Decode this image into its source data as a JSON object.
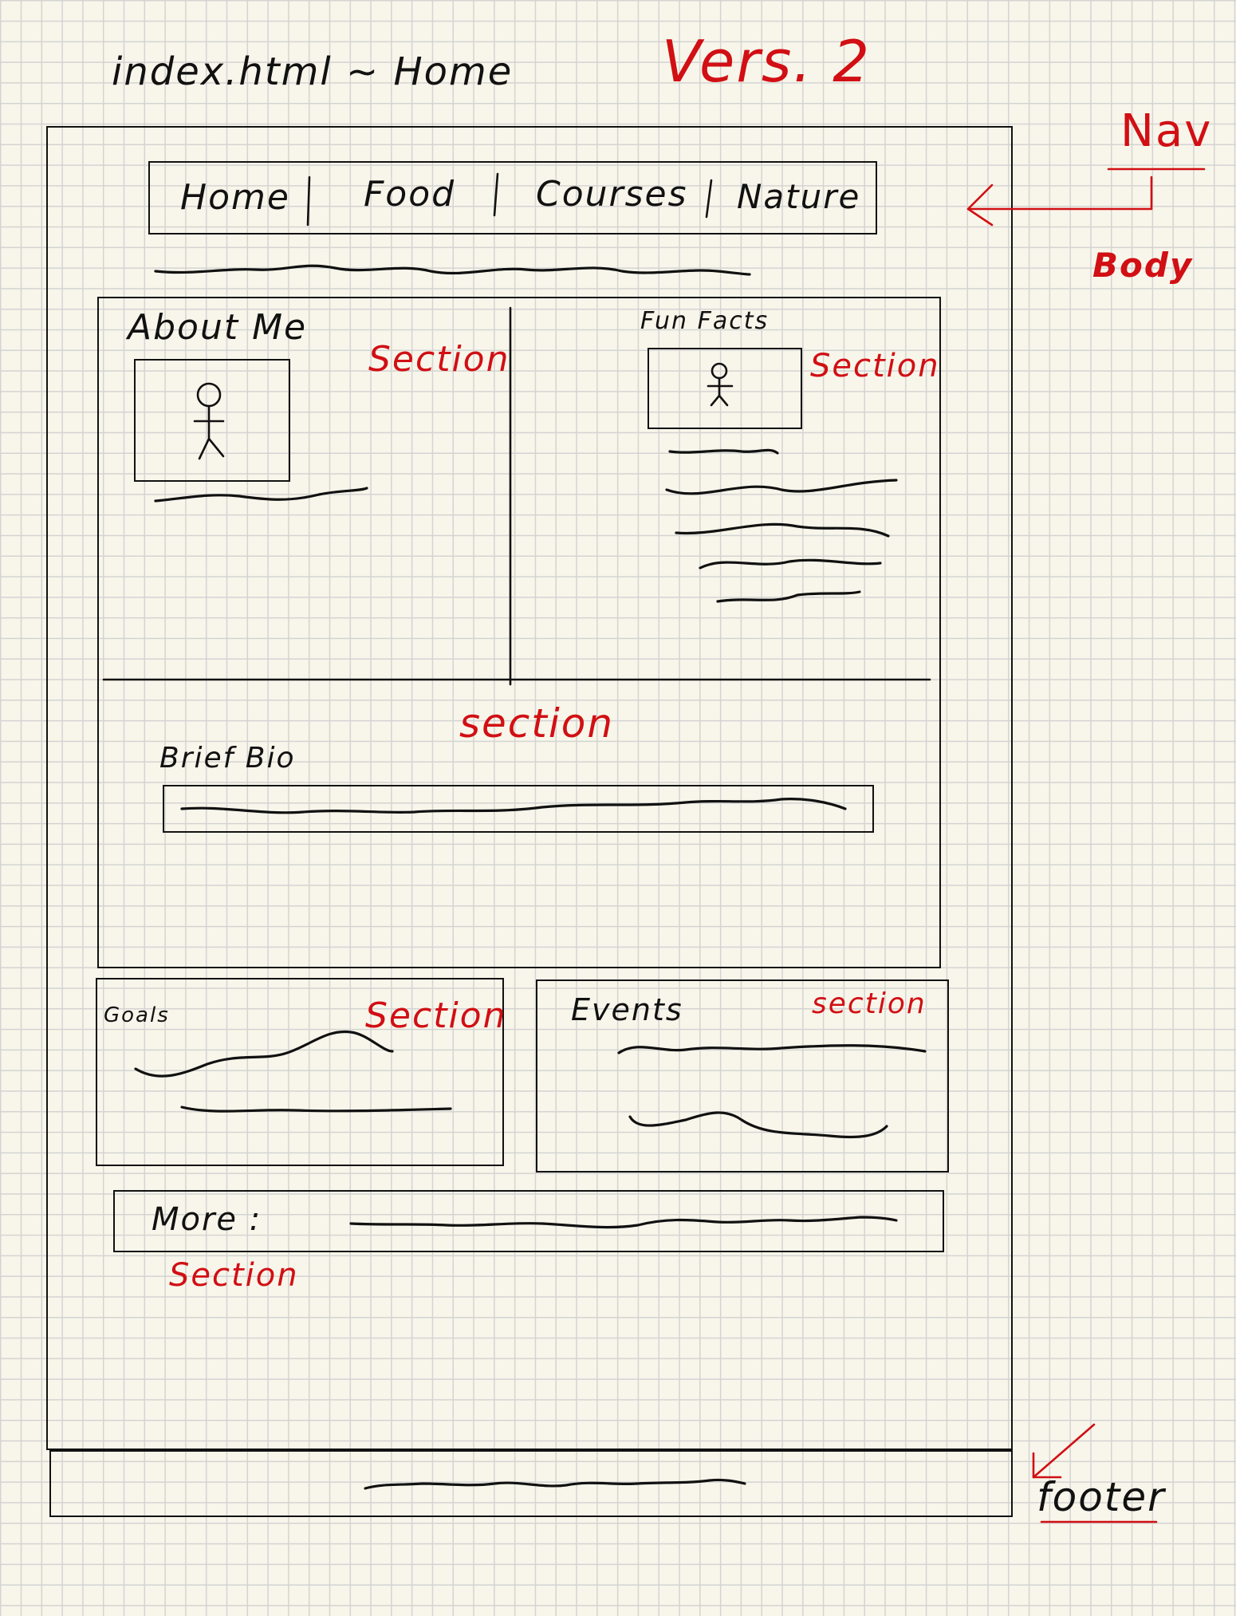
{
  "sketch": {
    "file_title": "index.html ~ Home",
    "version": "Vers. 2",
    "annotations": {
      "nav": "Nav",
      "body": "Body",
      "footer": "footer"
    },
    "nav": {
      "items": [
        "Home",
        "Food",
        "Courses",
        "Nature"
      ]
    },
    "sections": {
      "about_me": {
        "heading": "About Me",
        "tag": "Section"
      },
      "fun_facts": {
        "heading": "Fun Facts",
        "tag": "Section"
      },
      "brief_bio": {
        "heading": "Brief Bio",
        "tag": "section"
      },
      "goals": {
        "heading": "Goals",
        "tag": "Section"
      },
      "events": {
        "heading": "Events",
        "tag": "section"
      },
      "more": {
        "heading": "More :",
        "tag": "Section"
      }
    }
  }
}
